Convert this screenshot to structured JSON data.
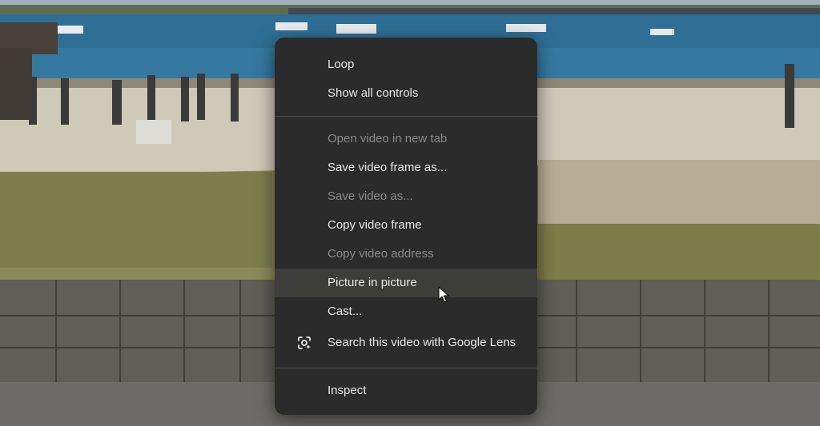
{
  "context_menu": {
    "items": [
      {
        "label": "Loop",
        "enabled": true
      },
      {
        "label": "Show all controls",
        "enabled": true
      },
      {
        "label": "Open video in new tab",
        "enabled": false
      },
      {
        "label": "Save video frame as...",
        "enabled": true
      },
      {
        "label": "Save video as...",
        "enabled": false
      },
      {
        "label": "Copy video frame",
        "enabled": true
      },
      {
        "label": "Copy video address",
        "enabled": false
      },
      {
        "label": "Picture in picture",
        "enabled": true,
        "hovered": true
      },
      {
        "label": "Cast...",
        "enabled": true
      },
      {
        "label": "Search this video with Google Lens",
        "enabled": true,
        "icon": "google-lens-icon"
      },
      {
        "label": "Inspect",
        "enabled": true
      }
    ]
  },
  "colors": {
    "menu_bg": "#2b2b2b",
    "menu_hover": "#3d3d3b",
    "menu_text": "#e8e8e8",
    "menu_text_disabled": "#8a8a8a",
    "separator": "#4a4a4a"
  }
}
